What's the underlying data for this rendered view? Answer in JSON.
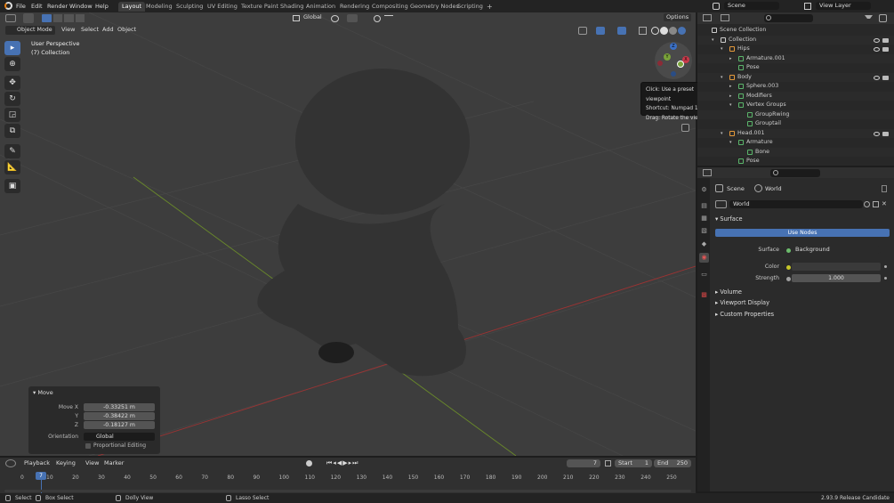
{
  "menu": [
    "File",
    "Edit",
    "Render",
    "Window",
    "Help"
  ],
  "workspaces": [
    "Layout",
    "Modeling",
    "Sculpting",
    "UV Editing",
    "Texture Paint",
    "Shading",
    "Animation",
    "Rendering",
    "Compositing",
    "Geometry Nodes",
    "Scripting"
  ],
  "workspace_add": "+",
  "scene_name": "Scene",
  "view_layer": "View Layer",
  "viewport": {
    "transform_orientation": "Global",
    "options_label": "Options",
    "mode": "Object Mode",
    "menus": [
      "View",
      "Select",
      "Add",
      "Object"
    ],
    "perspective_label": "User Perspective",
    "collection_label": "(7) Collection"
  },
  "gizmo": {
    "x": "X",
    "y": "Y",
    "z": "Z"
  },
  "tooltip": {
    "line1": "Click: Use a preset viewpoint",
    "line2": "Shortcut: Numpad 1",
    "line3": "Drag: Rotate the view"
  },
  "outliner": {
    "rows": [
      {
        "label": "Scene Collection",
        "indent": 0
      },
      {
        "label": "Collection",
        "indent": 1
      },
      {
        "label": "Hips",
        "indent": 2
      },
      {
        "label": "Armature.001",
        "indent": 3
      },
      {
        "label": "Pose",
        "indent": 3
      },
      {
        "label": "Body",
        "indent": 2
      },
      {
        "label": "Sphere.003",
        "indent": 3
      },
      {
        "label": "Modifiers",
        "indent": 3
      },
      {
        "label": "Vertex Groups",
        "indent": 3
      },
      {
        "label": "GroupRwing",
        "indent": 4
      },
      {
        "label": "Grouptail",
        "indent": 4
      },
      {
        "label": "Head.001",
        "indent": 2
      },
      {
        "label": "Armature",
        "indent": 3
      },
      {
        "label": "Bone",
        "indent": 4
      },
      {
        "label": "Pose",
        "indent": 3
      }
    ]
  },
  "properties": {
    "breadcrumb_scene": "Scene",
    "breadcrumb_world": "World",
    "world_name": "World",
    "surface_section": "Surface",
    "use_nodes": "Use Nodes",
    "surface_label": "Surface",
    "surface_value": "Background",
    "color_label": "Color",
    "strength_label": "Strength",
    "strength_value": "1.000",
    "collapsed_sections": [
      "Volume",
      "Viewport Display",
      "Custom Properties"
    ]
  },
  "redo_panel": {
    "title": "Move",
    "move_x_label": "Move X",
    "move_x": "-0.33251 m",
    "y_label": "Y",
    "y_value": "-0.38422 m",
    "z_label": "Z",
    "z_value": "-0.18127 m",
    "orientation_label": "Orientation",
    "orientation_value": "Global",
    "proportional": "Proportional Editing"
  },
  "timeline": {
    "menus": [
      "Playback",
      "Keying",
      "View",
      "Marker"
    ],
    "current_frame": "7",
    "start_label": "Start",
    "start": "1",
    "end_label": "End",
    "end": "250",
    "ticks": [
      "0",
      "10",
      "20",
      "30",
      "40",
      "50",
      "60",
      "70",
      "80",
      "90",
      "100",
      "110",
      "120",
      "130",
      "140",
      "150",
      "160",
      "170",
      "180",
      "190",
      "200",
      "210",
      "220",
      "230",
      "240",
      "250"
    ],
    "playhead_label": "7"
  },
  "statusbar": {
    "select": "Select",
    "box_select": "Box Select",
    "dolly_view": "Dolly View",
    "lasso_select": "Lasso Select",
    "version": "2.93.9 Release Candidate"
  },
  "colors": {
    "accent": "#4772b3",
    "viewport_bg": "#3d3d3d",
    "x_axis": "#9b3333",
    "y_axis": "#6a8a2a"
  }
}
